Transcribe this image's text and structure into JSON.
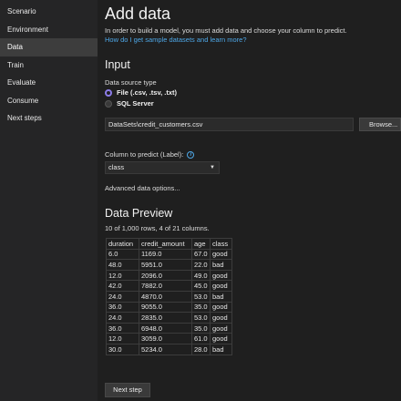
{
  "sidebar": {
    "items": [
      {
        "label": "Scenario"
      },
      {
        "label": "Environment"
      },
      {
        "label": "Data"
      },
      {
        "label": "Train"
      },
      {
        "label": "Evaluate"
      },
      {
        "label": "Consume"
      },
      {
        "label": "Next steps"
      }
    ]
  },
  "main": {
    "title": "Add data",
    "description": "In order to build a model, you must add data and choose your column to predict.",
    "help_link": "How do I get sample datasets and learn more?",
    "input_heading": "Input",
    "data_source_label": "Data source type",
    "source_options": [
      {
        "label": "File (.csv, .tsv, .txt)"
      },
      {
        "label": "SQL Server"
      }
    ],
    "file_path": "DataSets\\credit_customers.csv",
    "browse_label": "Browse...",
    "column_label": "Column to predict (Label):",
    "column_value": "class",
    "advanced_link": "Advanced data options...",
    "preview_heading": "Data Preview",
    "preview_summary": "10 of 1,000 rows, 4 of 21 columns.",
    "next_button": "Next step"
  },
  "table": {
    "headers": [
      "duration",
      "credit_amount",
      "age",
      "class"
    ],
    "rows": [
      [
        "6.0",
        "1169.0",
        "67.0",
        "good"
      ],
      [
        "48.0",
        "5951.0",
        "22.0",
        "bad"
      ],
      [
        "12.0",
        "2096.0",
        "49.0",
        "good"
      ],
      [
        "42.0",
        "7882.0",
        "45.0",
        "good"
      ],
      [
        "24.0",
        "4870.0",
        "53.0",
        "bad"
      ],
      [
        "36.0",
        "9055.0",
        "35.0",
        "good"
      ],
      [
        "24.0",
        "2835.0",
        "53.0",
        "good"
      ],
      [
        "36.0",
        "6948.0",
        "35.0",
        "good"
      ],
      [
        "12.0",
        "3059.0",
        "61.0",
        "good"
      ],
      [
        "30.0",
        "5234.0",
        "28.0",
        "bad"
      ]
    ]
  },
  "colors": {
    "background": "#1f1f1f",
    "sidebar": "#252526",
    "link": "#4ea8e8",
    "radio_accent": "#8c7ce8"
  }
}
